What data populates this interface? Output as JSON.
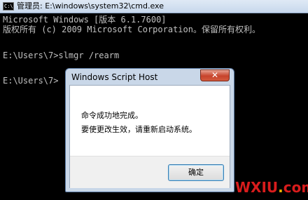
{
  "window": {
    "icon_text": "C:\\",
    "title": "管理员: E:\\windows\\system32\\cmd.exe"
  },
  "console": {
    "lines": [
      "Microsoft Windows [版本 6.1.7600]",
      "版权所有 (c) 2009 Microsoft Corporation。保留所有权利。",
      "",
      "E:\\Users\\7>slmgr /rearm",
      "",
      "E:\\Users\\7>"
    ]
  },
  "dialog": {
    "title": "Windows Script Host",
    "close_label": "✕",
    "message_line1": "命令成功地完成。",
    "message_line2": "要使更改生效，请重新启动系统。",
    "ok_label": "确定"
  },
  "watermark": {
    "text_main": "WXIU",
    "text_dot": ".",
    "text_end": "com"
  }
}
